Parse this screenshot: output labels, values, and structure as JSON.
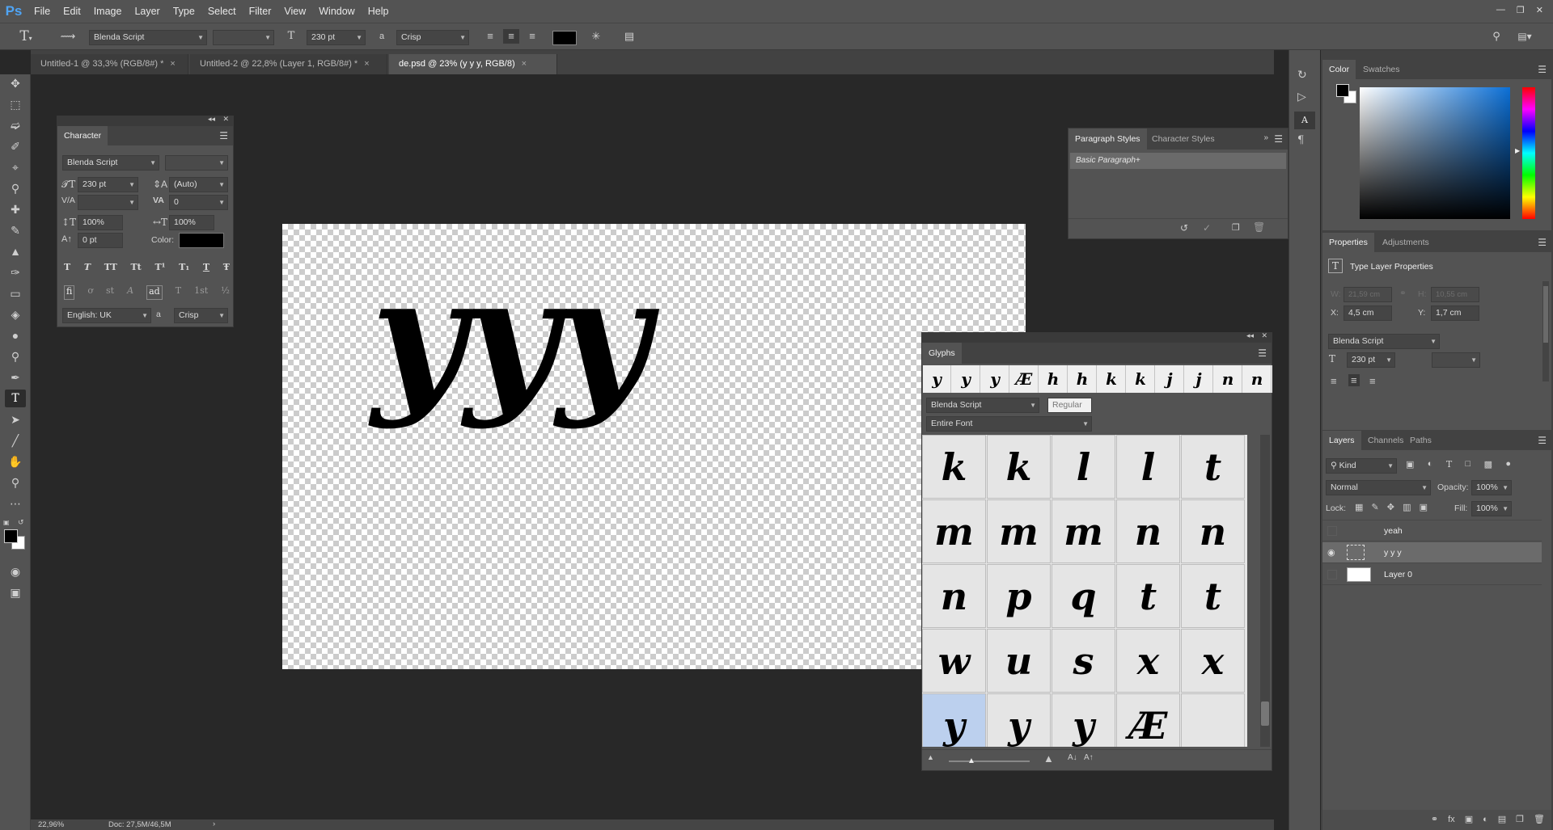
{
  "app": {
    "logo": "Ps"
  },
  "menu": [
    "File",
    "Edit",
    "Image",
    "Layer",
    "Type",
    "Select",
    "Filter",
    "View",
    "Window",
    "Help"
  ],
  "window_controls": [
    "minimize",
    "restore",
    "close"
  ],
  "options": {
    "font_family": "Blenda Script",
    "font_style": "",
    "font_size": "230 pt",
    "antialias_icon": "a",
    "antialias": "Crisp",
    "text_color": "#000000"
  },
  "doc_tabs": [
    {
      "label": "Untitled-1 @ 33,3% (RGB/8#) *",
      "close": "×"
    },
    {
      "label": "Untitled-2 @ 22,8% (Layer 1, RGB/8#) *",
      "close": "×"
    },
    {
      "label": "de.psd @ 23% (y  y  y, RGB/8)",
      "close": "×"
    }
  ],
  "canvas": {
    "text": "yyy"
  },
  "character": {
    "title": "Character",
    "font_family": "Blenda Script",
    "font_style": "",
    "size": "230 pt",
    "leading": "(Auto)",
    "kerning": "",
    "tracking": "0",
    "vscale": "100%",
    "hscale": "100%",
    "baseline": "0 pt",
    "color_label": "Color:",
    "color_value": "#000000",
    "style_buttons": [
      "T",
      "T",
      "TT",
      "Tt",
      "T¹",
      "T₁",
      "T",
      "Ŧ"
    ],
    "opentype_buttons": [
      "fi",
      "ơ",
      "st",
      "A",
      "ad",
      "T",
      "1st",
      "½"
    ],
    "language": "English: UK",
    "aa_icon": "a",
    "antialias": "Crisp"
  },
  "para_styles": {
    "tabs": [
      "Paragraph Styles",
      "Character Styles"
    ],
    "item": "Basic Paragraph+"
  },
  "glyphs": {
    "title": "Glyphs",
    "recent": [
      "y",
      "y",
      "y",
      "Æ",
      "h",
      "h",
      "k",
      "k",
      "j",
      "j",
      "n",
      "n"
    ],
    "font": "Blenda Script",
    "style": "Regular",
    "show": "Entire Font",
    "rows": [
      [
        "k",
        "k",
        "l",
        "l",
        "t"
      ],
      [
        "m",
        "m",
        "m",
        "n",
        "n"
      ],
      [
        "n",
        "p",
        "q",
        "t",
        "t"
      ],
      [
        "w",
        "u",
        "s",
        "x",
        "x"
      ],
      [
        "y",
        "y",
        "y",
        "Æ",
        ""
      ]
    ]
  },
  "color_panel": {
    "tabs": [
      "Color",
      "Swatches"
    ],
    "foreground": "#000000",
    "background": "#ffffff",
    "hue": "#0b6fd6"
  },
  "properties": {
    "tabs": [
      "Properties",
      "Adjustments"
    ],
    "title": "Type Layer Properties",
    "w_label": "W:",
    "w": "21,59 cm",
    "h_label": "H:",
    "h": "10,55 cm",
    "x_label": "X:",
    "x": "4,5 cm",
    "y_label": "Y:",
    "y": "1,7 cm",
    "font": "Blenda Script",
    "size": "230 pt",
    "style": ""
  },
  "layers": {
    "tabs": [
      "Layers",
      "Channels",
      "Paths"
    ],
    "filter": "Kind",
    "blend": "Normal",
    "opacity_label": "Opacity:",
    "opacity": "100%",
    "lock_label": "Lock:",
    "fill_label": "Fill:",
    "fill": "100%",
    "items": [
      {
        "name": "yeah",
        "type": "T",
        "visible": false,
        "selected": false
      },
      {
        "name": "y  y  y",
        "type": "T",
        "visible": true,
        "selected": true
      },
      {
        "name": "Layer 0",
        "type": "raster",
        "visible": false,
        "selected": false
      }
    ]
  },
  "status": {
    "zoom": "22,96%",
    "doc": "Doc: 27,5M/46,5M",
    "arrow": "›"
  }
}
